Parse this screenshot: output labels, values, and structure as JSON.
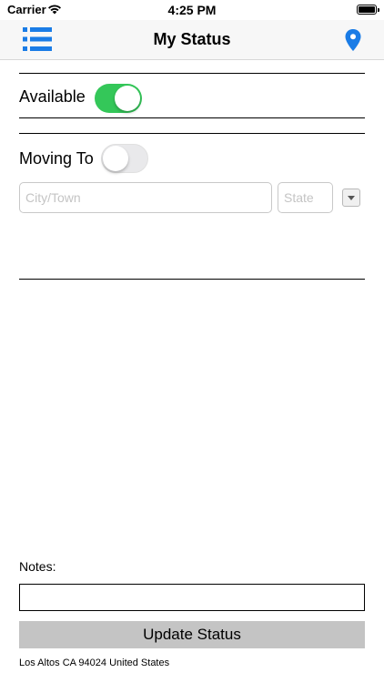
{
  "status_bar": {
    "carrier": "Carrier",
    "time": "4:25 PM"
  },
  "nav": {
    "title": "My Status",
    "menu_icon": "list-icon",
    "location_icon": "map-pin-icon",
    "accent": "#1a7ce6"
  },
  "available": {
    "label": "Available",
    "on": true,
    "on_color": "#34c759"
  },
  "moving_to": {
    "label": "Moving To",
    "on": false,
    "city": {
      "value": "",
      "placeholder": "City/Town"
    },
    "state": {
      "value": "",
      "placeholder": "State"
    },
    "dropdown_icon": "chevron-down-icon"
  },
  "notes": {
    "label": "Notes:",
    "value": ""
  },
  "update_button": {
    "label": "Update Status"
  },
  "location": {
    "text": "Los Altos CA 94024 United States"
  }
}
